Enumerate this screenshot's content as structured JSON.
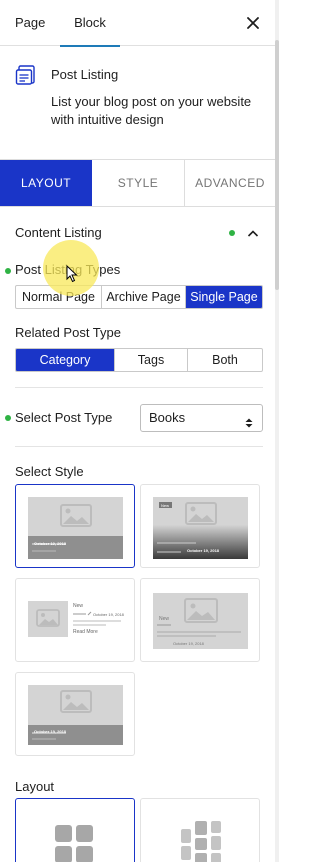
{
  "tabs": {
    "page": "Page",
    "block": "Block"
  },
  "icons": {
    "close": "close-icon",
    "block": "post-listing-icon",
    "collapse": "chevron-up-icon",
    "select": "select-caret-icon"
  },
  "block": {
    "title": "Post Listing",
    "description": "List your blog post on your website with intuitive design"
  },
  "panel_tabs": {
    "layout": "LAYOUT",
    "style": "STYLE",
    "advanced": "ADVANCED"
  },
  "content_listing": {
    "title": "Content Listing",
    "listing_types": {
      "label": "Post Listing Types",
      "options": [
        "Normal Page",
        "Archive Page",
        "Single Page"
      ],
      "selected": "Single Page"
    },
    "related_post_type": {
      "label": "Related Post Type",
      "options": [
        "Category",
        "Tags",
        "Both"
      ],
      "selected": "Category"
    },
    "select_post_type": {
      "label": "Select Post Type",
      "value": "Books"
    },
    "select_style": {
      "label": "Select Style",
      "dates": [
        "October 19, 2018",
        "October 19, 2018",
        "October 19, 2018",
        "October 19, 2018",
        "October 19, 2018"
      ],
      "new_badge": "New",
      "read_more": "Read More"
    },
    "layout": {
      "label": "Layout"
    }
  },
  "colors": {
    "accent": "#1a35c8",
    "active_dot": "#2fb344",
    "tab_underline": "#1e7bb8",
    "highlight": "#f8e85a"
  }
}
